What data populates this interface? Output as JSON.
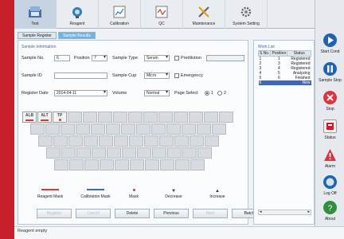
{
  "toolbar": [
    {
      "label": "Test",
      "icon": "test-icon"
    },
    {
      "label": "Reagent",
      "icon": "reagent-icon"
    },
    {
      "label": "Calibration",
      "icon": "calibration-icon"
    },
    {
      "label": "QC",
      "icon": "qc-icon"
    },
    {
      "label": "Maintenance",
      "icon": "maintenance-icon"
    },
    {
      "label": "System Setting",
      "icon": "system-setting-icon"
    }
  ],
  "tabs": [
    "Sample Register",
    "Sample Results"
  ],
  "form": {
    "section_title": "Sample Information",
    "sample_no_label": "Sample No.",
    "sample_no_value": "6",
    "position_label": "Position",
    "position_value": "7",
    "sample_type_label": "Sample Type",
    "sample_type_value": "Serum",
    "predilution_label": "Predilution",
    "sample_id_label": "Sample ID",
    "sample_id_value": "",
    "sample_cup_label": "Sample Cup",
    "sample_cup_value": "Micro",
    "emergency_label": "Emergency",
    "register_date_label": "Register Date",
    "register_date_value": "2014-04-11",
    "volume_label": "Volume",
    "volume_value": "Normal",
    "page_select_label": "Page Select",
    "page_1": "1",
    "page_2": "2"
  },
  "tests": [
    "ALB",
    "ALT",
    "TP"
  ],
  "legend": [
    {
      "label": "Reagent Mask",
      "color": "#d9363e"
    },
    {
      "label": "Calibration Mask",
      "color": "#3a6ea5"
    },
    {
      "label": "Mask",
      "color": "#c0396b"
    },
    {
      "label": "Decrease",
      "glyph": "▼"
    },
    {
      "label": "Increase",
      "glyph": "▲"
    }
  ],
  "buttons": [
    "Register",
    "Cancel",
    "Delete",
    "Previous",
    "Next",
    "Batch"
  ],
  "worklist": {
    "title": "Work List",
    "headers": [
      "S.No.",
      "Position",
      "Status"
    ],
    "rows": [
      [
        "1",
        "1",
        "Registered"
      ],
      [
        "2",
        "3",
        "Registered"
      ],
      [
        "3",
        "4",
        "Registered"
      ],
      [
        "4",
        "5",
        "Analyzing"
      ],
      [
        "5",
        "6",
        "Finished"
      ],
      [
        "6",
        "",
        "New"
      ]
    ]
  },
  "side": [
    {
      "label": "Start Cond",
      "color": "#1e63b4"
    },
    {
      "label": "Sample Stop",
      "color": "#1e63b4"
    },
    {
      "label": "Stop",
      "color": "#d9363e"
    },
    {
      "label": "Status",
      "color": "#c8202a"
    },
    {
      "label": "Alarm",
      "color": "#d9363e"
    },
    {
      "label": "Log Off",
      "color": "#1e63b4"
    },
    {
      "label": "About",
      "color": "#2f8f3b"
    }
  ],
  "status_text": "Reagent empty"
}
